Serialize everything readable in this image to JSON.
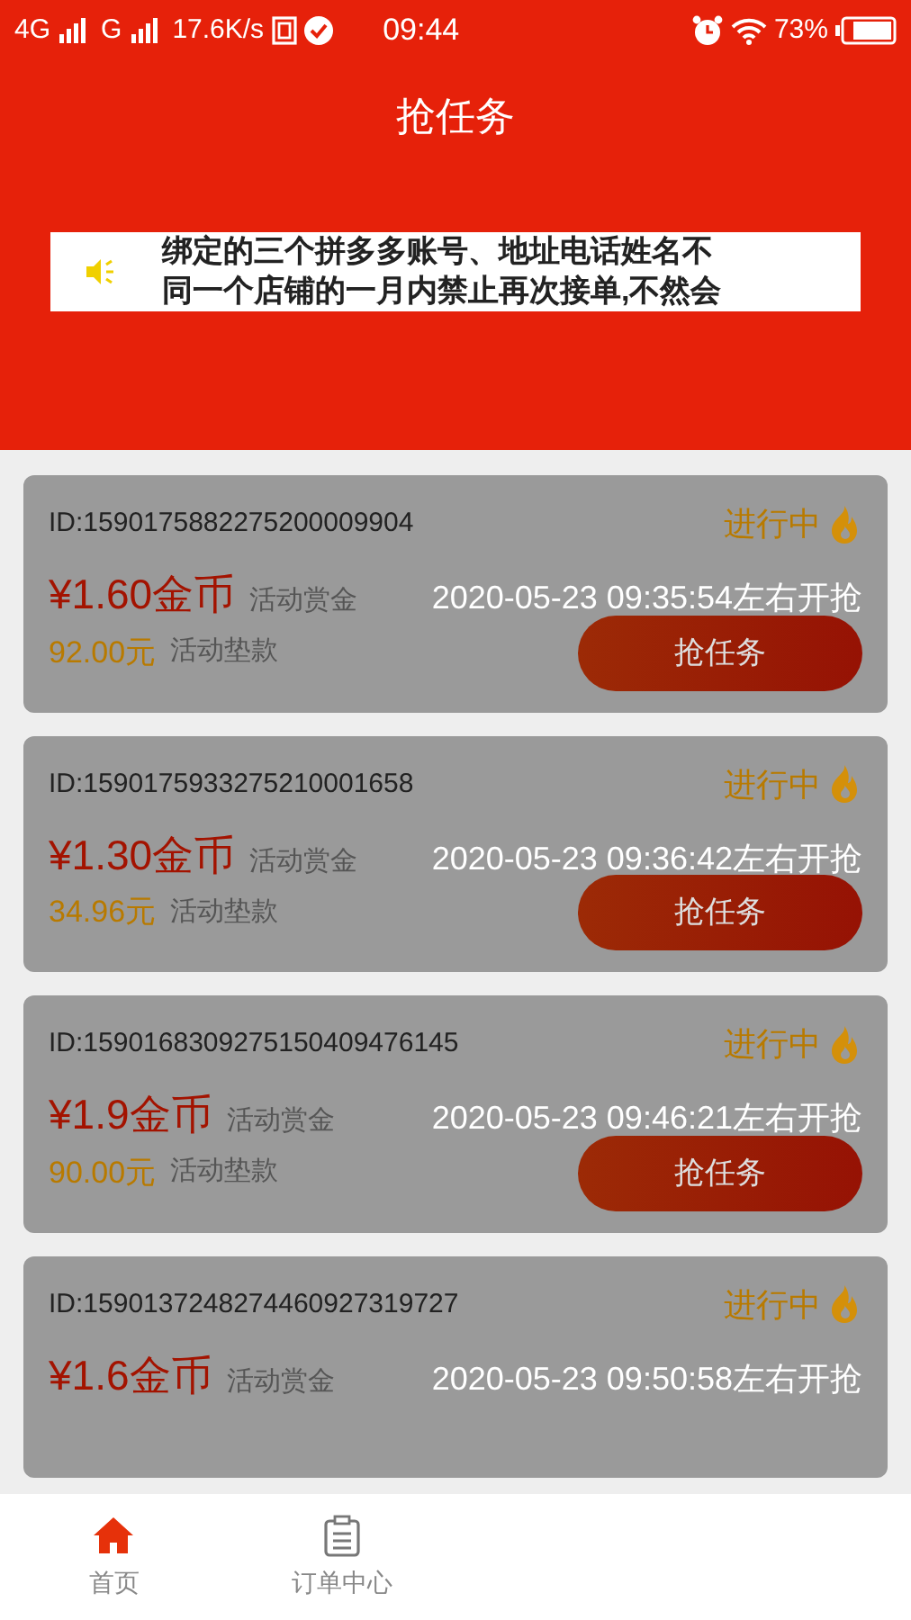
{
  "status_bar": {
    "network_1": "4G",
    "network_2": "G",
    "speed": "17.6K/s",
    "time": "09:44",
    "battery": "73%"
  },
  "header": {
    "title": "抢任务"
  },
  "notice": {
    "lines": [
      "绑定的三个拼多多账号、地址电话姓名不",
      "同一个店铺的一月内禁止再次接单,不然会"
    ]
  },
  "tasks": [
    {
      "id_text": "ID:1590175882275200009904",
      "status": "进行中",
      "reward": "¥1.60金币",
      "reward_label": "活动赏金",
      "start_time": "2020-05-23 09:35:54左右开抢",
      "deposit": "92.00元",
      "deposit_label": "活动垫款",
      "button": "抢任务",
      "disabled": true
    },
    {
      "id_text": "ID:1590175933275210001658",
      "status": "进行中",
      "reward": "¥1.30金币",
      "reward_label": "活动赏金",
      "start_time": "2020-05-23 09:36:42左右开抢",
      "deposit": "34.96元",
      "deposit_label": "活动垫款",
      "button": "抢任务",
      "disabled": true
    },
    {
      "id_text": "ID:1590168309275150409476145",
      "status": "进行中",
      "reward": "¥1.9金币",
      "reward_label": "活动赏金",
      "start_time": "2020-05-23 09:46:21左右开抢",
      "deposit": "90.00元",
      "deposit_label": "活动垫款",
      "button": "抢任务",
      "disabled": true
    },
    {
      "id_text": "ID:1590137248274460927319727",
      "status": "进行中",
      "reward": "¥1.6金币",
      "reward_label": "活动赏金",
      "start_time": "2020-05-23 09:50:58左右开抢",
      "disabled": true
    }
  ],
  "tab_bar": [
    {
      "label": "首页",
      "kind": "home",
      "selected": true
    },
    {
      "label": "订单中心",
      "kind": "orders",
      "selected": false
    }
  ]
}
